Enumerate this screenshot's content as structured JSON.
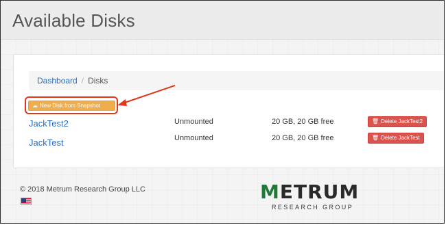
{
  "header": {
    "title": "Available Disks"
  },
  "breadcrumb": {
    "items": [
      "Dashboard",
      "Disks"
    ]
  },
  "actions": {
    "new_disk_label": "New Disk from Snapshot",
    "new_disk_icon": "cloud-upload-icon"
  },
  "disks": [
    {
      "name": "JackTest2",
      "status": "Unmounted",
      "size": "20 GB, 20 GB free",
      "delete_label": "Delete JackTest2"
    },
    {
      "name": "JackTest",
      "status": "Unmounted",
      "size": "20 GB, 20 GB free",
      "delete_label": "Delete JackTest"
    }
  ],
  "footer": {
    "copyright": "© 2018 Metrum Research Group LLC",
    "flag_icon": "us-flag-icon"
  },
  "logo": {
    "wordmark": "METRUM",
    "subtitle": "RESEARCH GROUP"
  },
  "colors": {
    "accent": "#f0ad4e",
    "danger": "#d9534f",
    "link": "#2a6ebb",
    "annotation": "#e0361a",
    "logo_green": "#1f7a3a"
  }
}
